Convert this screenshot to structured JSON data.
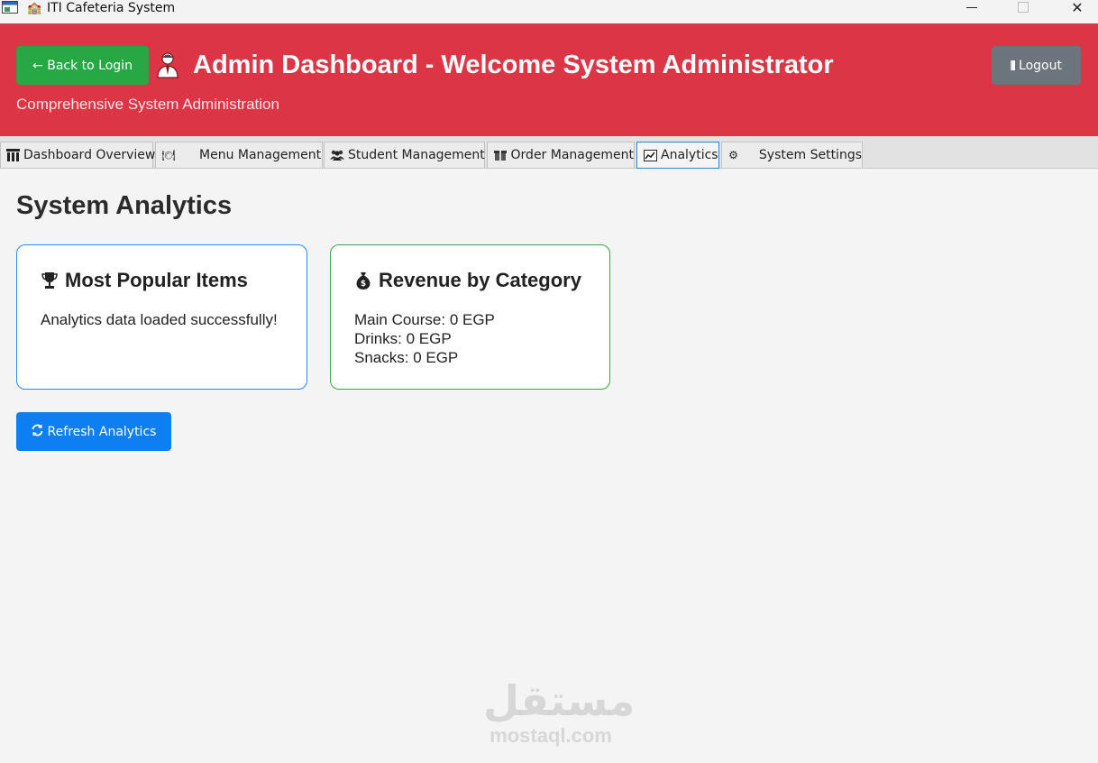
{
  "window": {
    "title": "ITI Cafeteria System",
    "title_emoji": "🏫",
    "close_glyph": "✕"
  },
  "header": {
    "back_label": "← Back to Login",
    "title": "Admin Dashboard - Welcome System Administrator",
    "subtitle": "Comprehensive System Administration",
    "logout_label": "Logout",
    "color": "#dc3545"
  },
  "tabs": [
    {
      "label": "Dashboard Overview",
      "icon": "columns-icon",
      "glyph": "🏛"
    },
    {
      "label": "Menu Management",
      "icon": "plate-icon",
      "glyph": "🍽"
    },
    {
      "label": "Student Management",
      "icon": "users-icon",
      "glyph": "👥"
    },
    {
      "label": "Order Management",
      "icon": "box-icon",
      "glyph": "📦"
    },
    {
      "label": "Analytics",
      "icon": "chart-icon",
      "glyph": "📈",
      "active": true
    },
    {
      "label": "System Settings",
      "icon": "gear-icon",
      "glyph": "⚙"
    }
  ],
  "main": {
    "title": "System Analytics",
    "popular": {
      "title": "Most Popular Items",
      "glyph": "🏆",
      "message": "Analytics data loaded successfully!"
    },
    "revenue": {
      "title": "Revenue by Category",
      "glyph": "💰",
      "lines": [
        "Main Course: 0 EGP",
        "Drinks: 0 EGP",
        "Snacks: 0 EGP"
      ]
    },
    "refresh_label": "Refresh Analytics",
    "refresh_glyph": "🔄"
  },
  "watermark": {
    "arabic": "مستقل",
    "latin": "mostaql.com"
  },
  "colors": {
    "back_button": "#28a745",
    "logout_button": "#6c757d",
    "refresh_button": "#0d7ff2",
    "popular_border": "#2a8cf0",
    "revenue_border": "#3fa14f"
  }
}
